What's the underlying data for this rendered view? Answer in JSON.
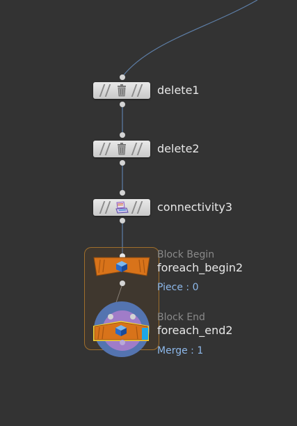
{
  "nodes": {
    "delete1": {
      "name": "delete1",
      "icon": "trash-icon"
    },
    "delete2": {
      "name": "delete2",
      "icon": "trash-icon"
    },
    "connectivity3": {
      "name": "connectivity3",
      "icon": "connectivity-icon"
    },
    "foreach_begin2": {
      "name": "foreach_begin2",
      "block_label": "Block Begin",
      "info": "Piece : 0",
      "icon": "block-cube-icon"
    },
    "foreach_end2": {
      "name": "foreach_end2",
      "block_label": "Block End",
      "info": "Merge : 1",
      "icon": "block-cube-icon"
    }
  },
  "colors": {
    "background": "#333333",
    "node_fill": "#d8d8d8",
    "block_orange": "#d8731a",
    "wire": "#5e7fa8",
    "info_text": "#8db8ea",
    "highlight_yellow": "#f5d23a",
    "flag_blue": "#1fa6e8"
  }
}
